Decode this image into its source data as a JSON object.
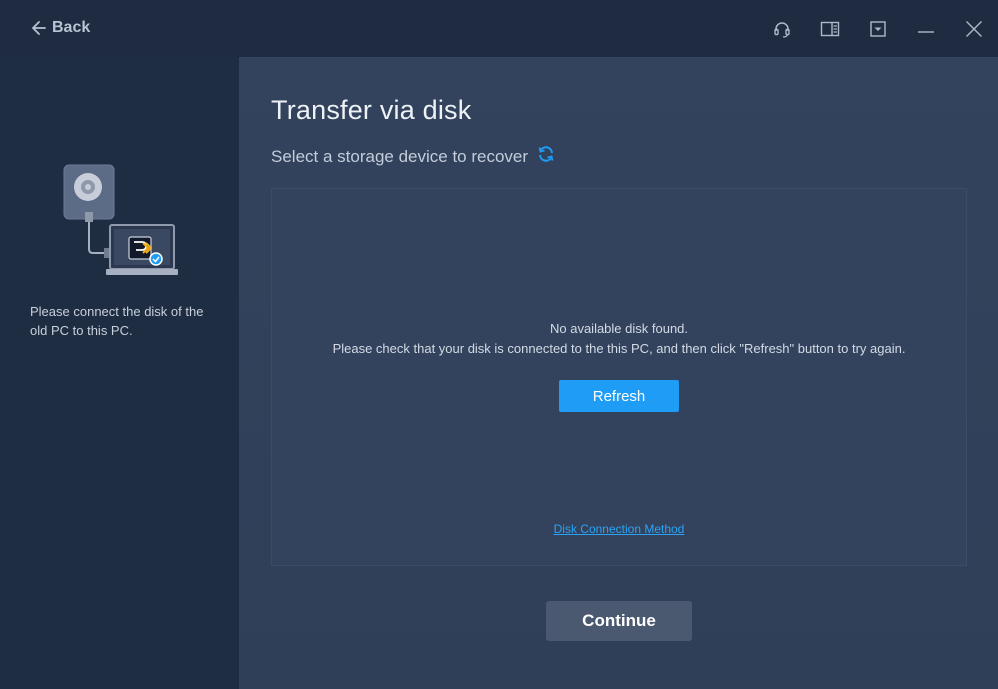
{
  "titlebar": {
    "back_label": "Back",
    "icons": [
      "headset-icon",
      "manual-icon",
      "dropdown-menu-icon",
      "minimize-icon",
      "close-icon"
    ]
  },
  "left_panel": {
    "hint": "Please connect the disk of the old PC to this PC."
  },
  "main": {
    "title": "Transfer via disk",
    "subtitle": "Select a storage device to recover",
    "empty_line1": "No available disk found.",
    "empty_line2": "Please check that your disk is connected to the this PC, and then click \"Refresh\" button to try again.",
    "refresh_label": "Refresh",
    "link_label": "Disk Connection Method",
    "continue_label": "Continue"
  },
  "colors": {
    "accent": "#1f9cf5",
    "link": "#2aa3f5",
    "background_dark": "#1e2b40",
    "panel": "#33435d",
    "continue_button": "#4a5970"
  }
}
